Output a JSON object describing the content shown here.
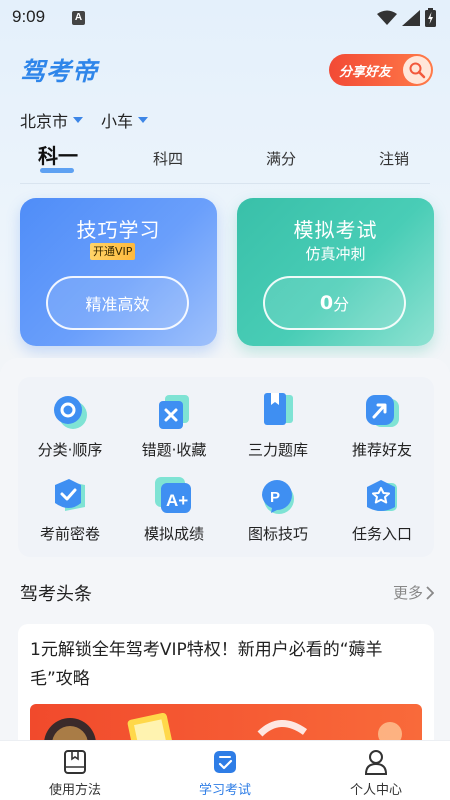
{
  "status_bar": {
    "time": "9:09",
    "notification_glyph": "A"
  },
  "header": {
    "logo_text": "驾考帝",
    "share_button_label": "分享好友",
    "city": "北京市",
    "vehicle": "小车"
  },
  "tabs": [
    {
      "label": "科一",
      "active": true
    },
    {
      "label": "科四",
      "active": false
    },
    {
      "label": "满分",
      "active": false
    },
    {
      "label": "注销",
      "active": false
    }
  ],
  "cards": {
    "skill": {
      "title": "技巧学习",
      "badge": "开通VIP",
      "button_label": "精准高效"
    },
    "mock": {
      "title": "模拟考试",
      "subtitle": "仿真冲刺",
      "score_value": "0",
      "score_unit": "分"
    }
  },
  "grid_items": [
    {
      "label": "分类·顺序",
      "icon": "circle-icon"
    },
    {
      "label": "错题·收藏",
      "icon": "wrong-x-icon"
    },
    {
      "label": "三力题库",
      "icon": "book-icon"
    },
    {
      "label": "推荐好友",
      "icon": "share-arrow-icon"
    },
    {
      "label": "考前密卷",
      "icon": "check-icon"
    },
    {
      "label": "模拟成绩",
      "icon": "grade-a-plus-icon"
    },
    {
      "label": "图标技巧",
      "icon": "parking-p-icon"
    },
    {
      "label": "任务入口",
      "icon": "star-badge-icon"
    }
  ],
  "news": {
    "header": "驾考头条",
    "more_label": "更多",
    "article_title": "1元解锁全年驾考VIP特权！新用户必看的“薅羊毛”攻略"
  },
  "bottom_nav": [
    {
      "label": "使用方法",
      "icon": "book-icon",
      "active": false
    },
    {
      "label": "学习考试",
      "icon": "checklist-icon",
      "active": true
    },
    {
      "label": "个人中心",
      "icon": "person-icon",
      "active": false
    }
  ],
  "colors": {
    "brand_blue": "#2f86ea",
    "card_blue": "#5b93f9",
    "card_green": "#3fc5ad",
    "share_red": "#f24a35",
    "nav_active": "#2e7de6"
  }
}
